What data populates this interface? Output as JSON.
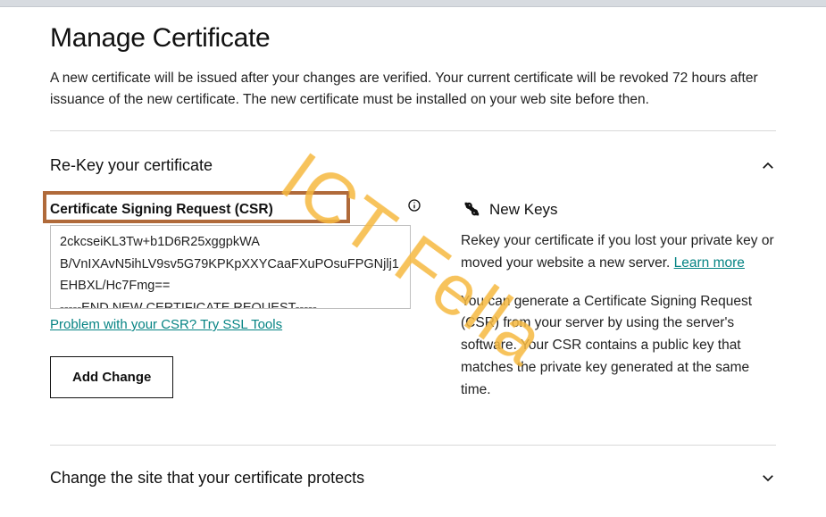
{
  "page": {
    "title": "Manage Certificate",
    "intro": "A new certificate will be issued after your changes are verified. Your current certificate will be revoked 72 hours after issuance of the new certificate. The new certificate must be installed on your web site before then."
  },
  "rekey": {
    "title": "Re-Key your certificate",
    "csr_label": "Certificate Signing Request (CSR)",
    "csr_value": "2ckcseiKL3Tw+b1D6R25xggpkWA\nB/VnIXAvN5ihLV9sv5G79KPKpXXYCaaFXuPOsuFPGNjlj1EHBXL/Hc7Fmg==\n-----END NEW CERTIFICATE REQUEST-----",
    "ssl_tools_link": "Problem with your CSR? Try SSL Tools",
    "add_change_label": "Add Change",
    "newkeys_title": "New Keys",
    "newkeys_para1_a": "Rekey your certificate if you lost your private key or moved your website a new server. ",
    "newkeys_learn_more": "Learn more",
    "newkeys_para2": "You can generate a Certificate Signing Request (CSR) from your server by using the server's software. Your CSR contains a public key that matches the private key generated at the same time."
  },
  "change_site": {
    "title": "Change the site that your certificate protects"
  },
  "watermark": "ICT Fella"
}
